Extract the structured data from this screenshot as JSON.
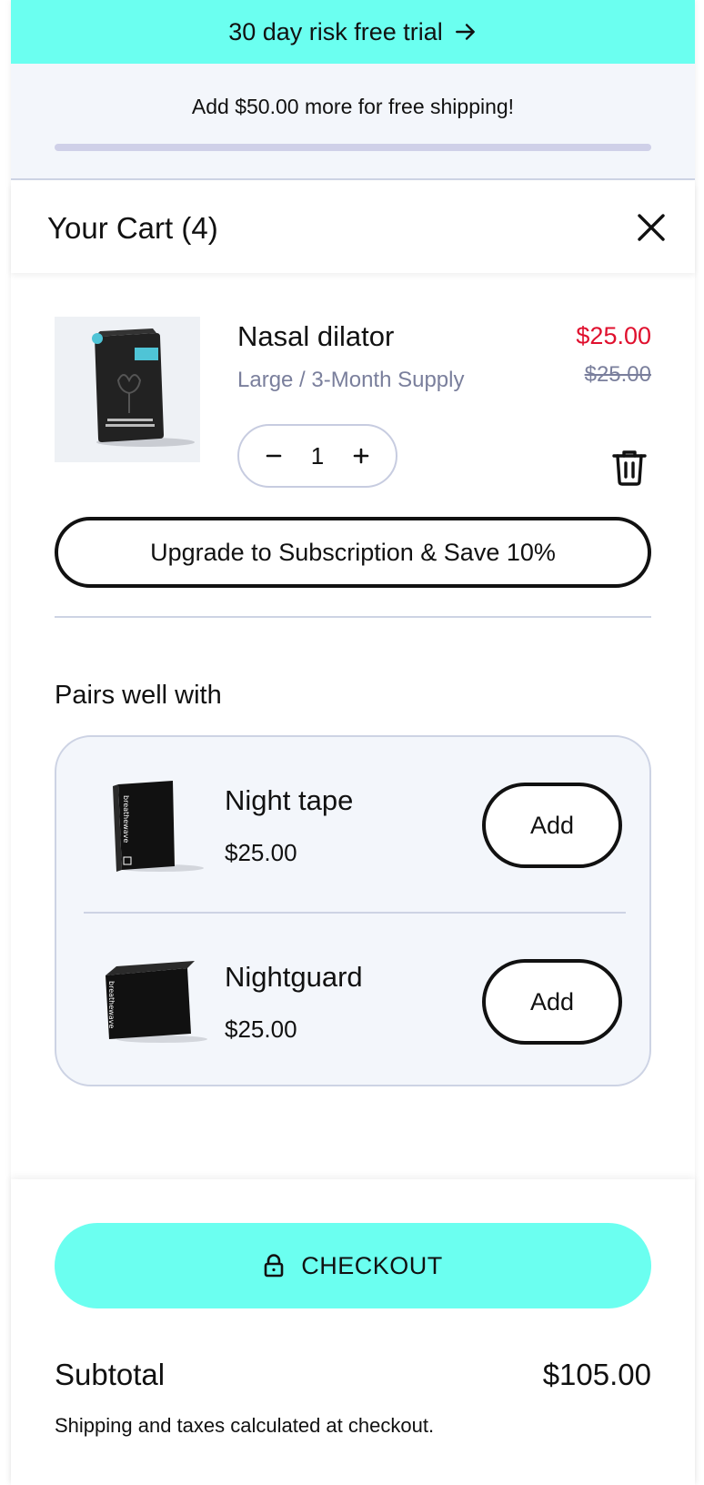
{
  "promo": {
    "text": "30 day risk free trial",
    "icon": "arrow-right-icon",
    "bg": "#6bfff0"
  },
  "shipping": {
    "message": "Add $50.00 more for free shipping!",
    "progress_fraction": 0.0
  },
  "header": {
    "title": "Your Cart (4)",
    "close_icon": "close-icon"
  },
  "cart_item": {
    "name": "Nasal dilator",
    "variant": "Large / 3-Month Supply",
    "price": "$25.00",
    "compare_price": "$25.00",
    "quantity": "1",
    "decrease_icon": "minus-icon",
    "increase_icon": "plus-icon",
    "remove_icon": "trash-icon",
    "price_color": "#e0102e"
  },
  "upgrade": {
    "label": "Upgrade to Subscription & Save 10%"
  },
  "pairs": {
    "title": "Pairs well with",
    "items": [
      {
        "name": "Night tape",
        "price": "$25.00",
        "add_label": "Add"
      },
      {
        "name": "Nightguard",
        "price": "$25.00",
        "add_label": "Add"
      }
    ]
  },
  "footer": {
    "checkout_label": "CHECKOUT",
    "checkout_icon": "lock-icon",
    "subtotal_label": "Subtotal",
    "subtotal_value": "$105.00",
    "note": "Shipping and taxes calculated at checkout."
  }
}
